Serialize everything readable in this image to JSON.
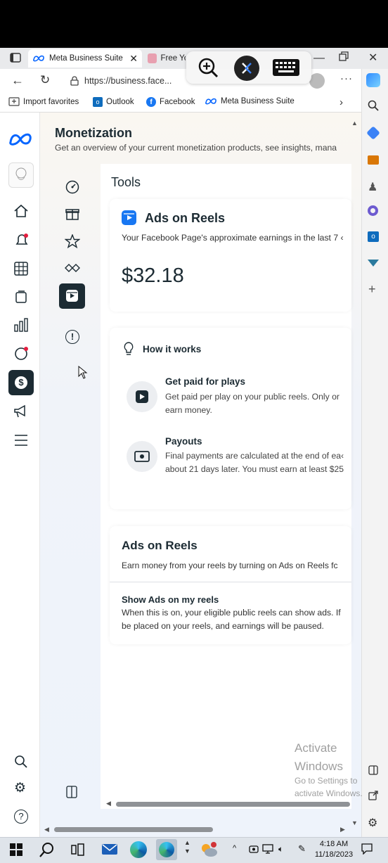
{
  "browser": {
    "active_tab_title": "Meta Business Suite",
    "inactive_tab_title": "Free Yo",
    "url": "https://business.face...",
    "favorites": [
      "Import favorites",
      "Outlook",
      "Facebook",
      "Meta Business Suite"
    ],
    "more_label": "···"
  },
  "page": {
    "title": "Monetization",
    "subtitle": "Get an overview of your current monetization products, see insights, mana",
    "tools_heading": "Tools"
  },
  "ads_card": {
    "title": "Ads on Reels",
    "description": "Your Facebook Page's approximate earnings in the last 7 ‹",
    "amount": "$32.18"
  },
  "how_it_works": {
    "title": "How it works",
    "items": [
      {
        "title": "Get paid for plays",
        "line1": "Get paid per play on your public reels. Only or",
        "line2": "earn money."
      },
      {
        "title": "Payouts",
        "line1": "Final payments are calculated at the end of ea‹",
        "line2": "about 21 days later. You must earn at least $25"
      }
    ]
  },
  "ads_section": {
    "title": "Ads on Reels",
    "description": "Earn money from your reels by turning on Ads on Reels fc",
    "toggle_title": "Show Ads on my reels",
    "toggle_line1": "When this is on, your eligible public reels can show ads. If",
    "toggle_line2": "be placed on your reels, and earnings will be paused."
  },
  "watermark": {
    "line1": "Activate",
    "line2": "Windows",
    "line3": "Go to Settings to",
    "line4": "activate Windows."
  },
  "taskbar": {
    "time": "4:18 AM",
    "date": "11/18/2023"
  },
  "colors": {
    "meta_blue": "#0866ff",
    "facebook_blue": "#1877f2",
    "dark_icon": "#1c2b33"
  }
}
